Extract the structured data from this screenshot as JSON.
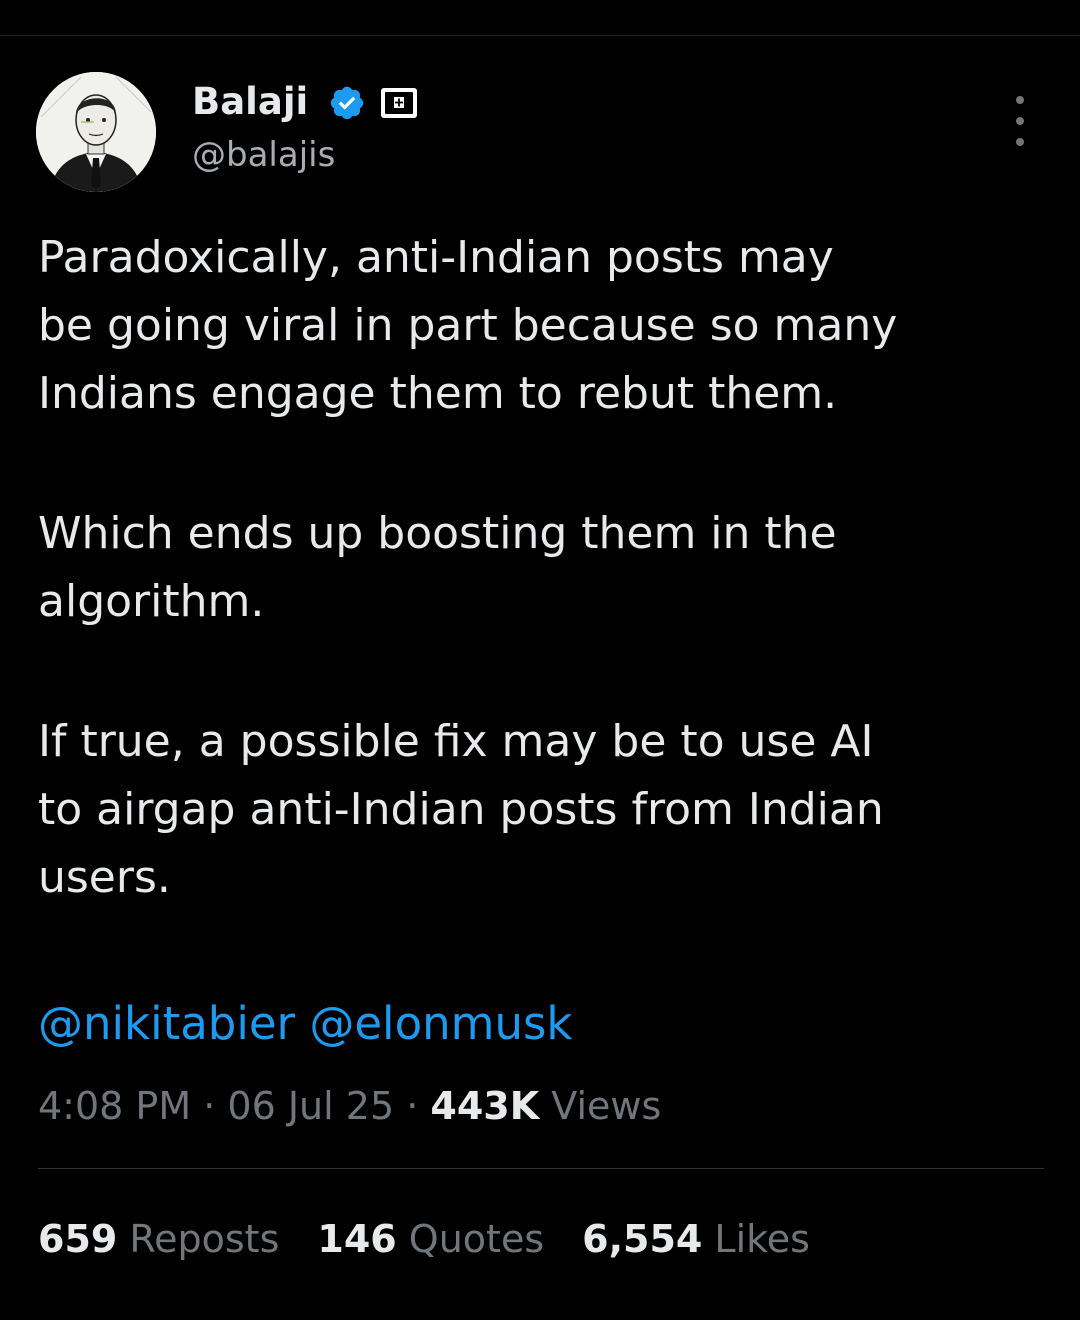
{
  "author": {
    "display_name": "Balaji",
    "handle": "@balajis",
    "verified_color": "#1d9bf0",
    "icons": [
      "verified-badge-icon",
      "affiliate-badge-icon"
    ]
  },
  "tweet": {
    "paragraphs": [
      "Paradoxically, anti-Indian posts may\nbe going viral in part because so many\nIndians engage them to rebut them.",
      "Which ends up boosting them in the\nalgorithm.",
      "If true, a possible fix may be to use AI\nto airgap anti-Indian posts from Indian\nusers."
    ],
    "mentions": [
      "@nikitabier",
      "@elonmusk"
    ]
  },
  "meta": {
    "time": "4:08 PM",
    "separator": "·",
    "date": "06 Jul 25",
    "views_count": "443K",
    "views_label": "Views"
  },
  "stats": [
    {
      "count": "659",
      "label": "Reposts"
    },
    {
      "count": "146",
      "label": "Quotes"
    },
    {
      "count": "6,554",
      "label": "Likes"
    }
  ],
  "colors": {
    "background": "#000000",
    "text": "#e7e9ea",
    "secondary": "#71767b",
    "link": "#1d9bf0"
  }
}
